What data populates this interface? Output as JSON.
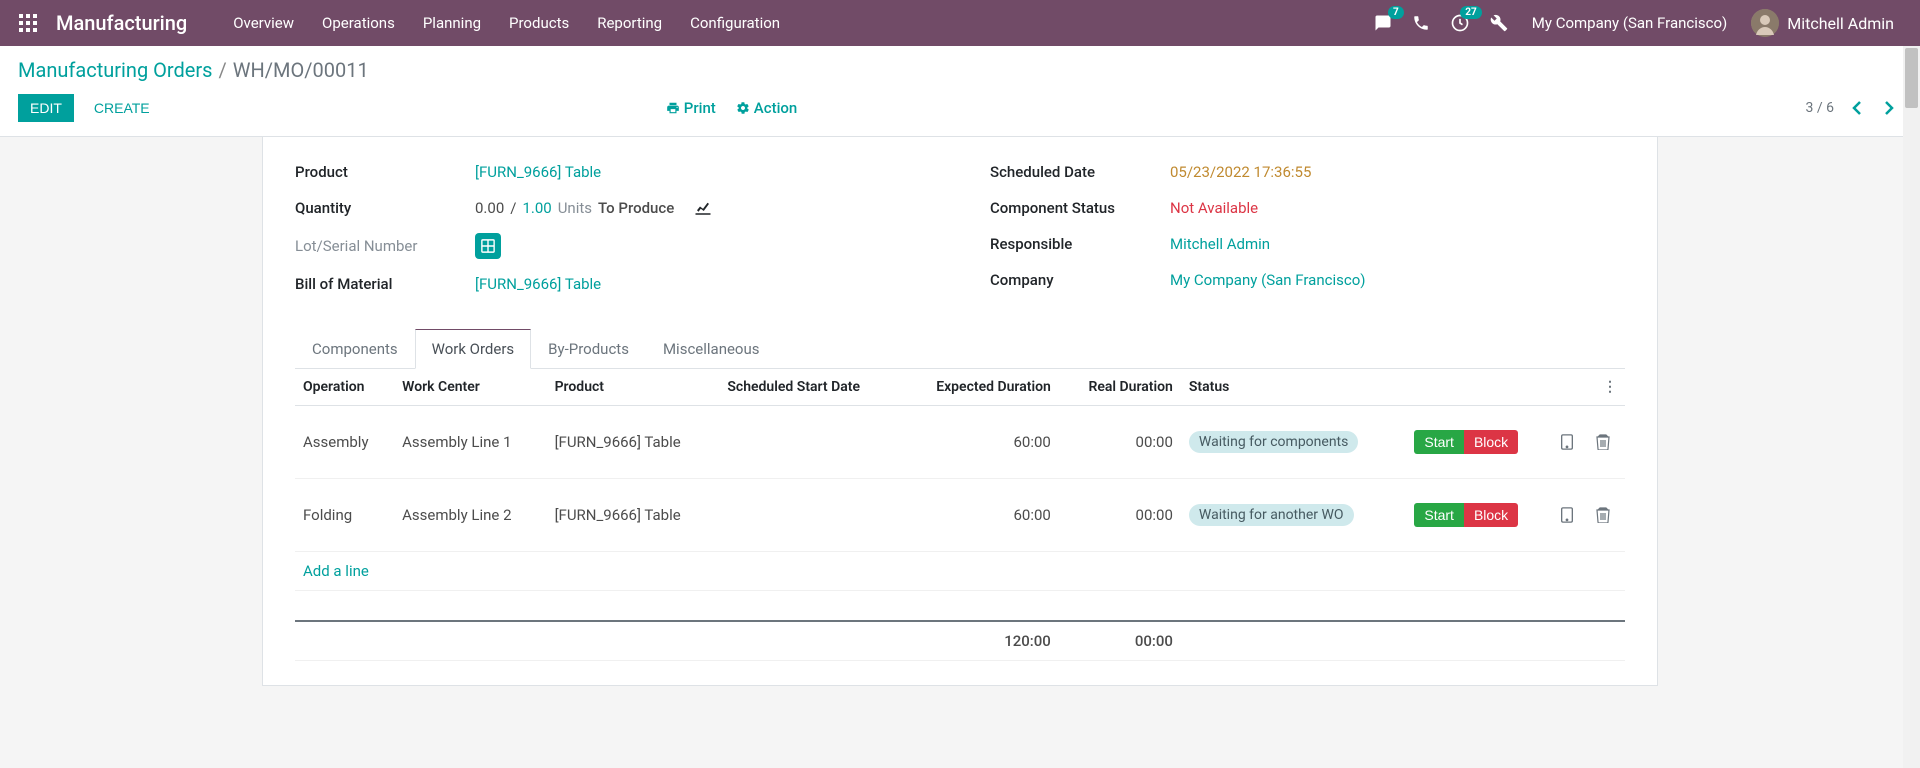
{
  "nav": {
    "brand": "Manufacturing",
    "menu": [
      "Overview",
      "Operations",
      "Planning",
      "Products",
      "Reporting",
      "Configuration"
    ],
    "chat_badge": "7",
    "activity_badge": "27",
    "company": "My Company (San Francisco)",
    "user": "Mitchell Admin"
  },
  "breadcrumb": {
    "parent": "Manufacturing Orders",
    "current": "WH/MO/00011"
  },
  "buttons": {
    "edit": "EDIT",
    "create": "CREATE",
    "print": "Print",
    "action": "Action"
  },
  "pager": {
    "pos": "3",
    "total": "6"
  },
  "left": {
    "product_label": "Product",
    "product_value": "[FURN_9666] Table",
    "quantity_label": "Quantity",
    "qty_done": "0.00",
    "qty_sep": "/",
    "qty_todo": "1.00",
    "qty_unit": "Units",
    "qty_state": "To Produce",
    "lot_label": "Lot/Serial Number",
    "bom_label": "Bill of Material",
    "bom_value": "[FURN_9666] Table"
  },
  "right": {
    "date_label": "Scheduled Date",
    "date_value": "05/23/2022 17:36:55",
    "comp_label": "Component Status",
    "comp_value": "Not Available",
    "resp_label": "Responsible",
    "resp_value": "Mitchell Admin",
    "company_label": "Company",
    "company_value": "My Company (San Francisco)"
  },
  "tabs": [
    "Components",
    "Work Orders",
    "By-Products",
    "Miscellaneous"
  ],
  "active_tab": 1,
  "columns": {
    "operation": "Operation",
    "work_center": "Work Center",
    "product": "Product",
    "sched": "Scheduled Start Date",
    "expected": "Expected Duration",
    "real": "Real Duration",
    "status": "Status"
  },
  "rows": [
    {
      "operation": "Assembly",
      "work_center": "Assembly Line 1",
      "product": "[FURN_9666] Table",
      "sched": "",
      "expected": "60:00",
      "real": "00:00",
      "status": "Waiting for components",
      "start": "Start",
      "block": "Block"
    },
    {
      "operation": "Folding",
      "work_center": "Assembly Line 2",
      "product": "[FURN_9666] Table",
      "sched": "",
      "expected": "60:00",
      "real": "00:00",
      "status": "Waiting for another WO",
      "start": "Start",
      "block": "Block"
    }
  ],
  "addline": "Add a line",
  "totals": {
    "expected": "120:00",
    "real": "00:00"
  }
}
